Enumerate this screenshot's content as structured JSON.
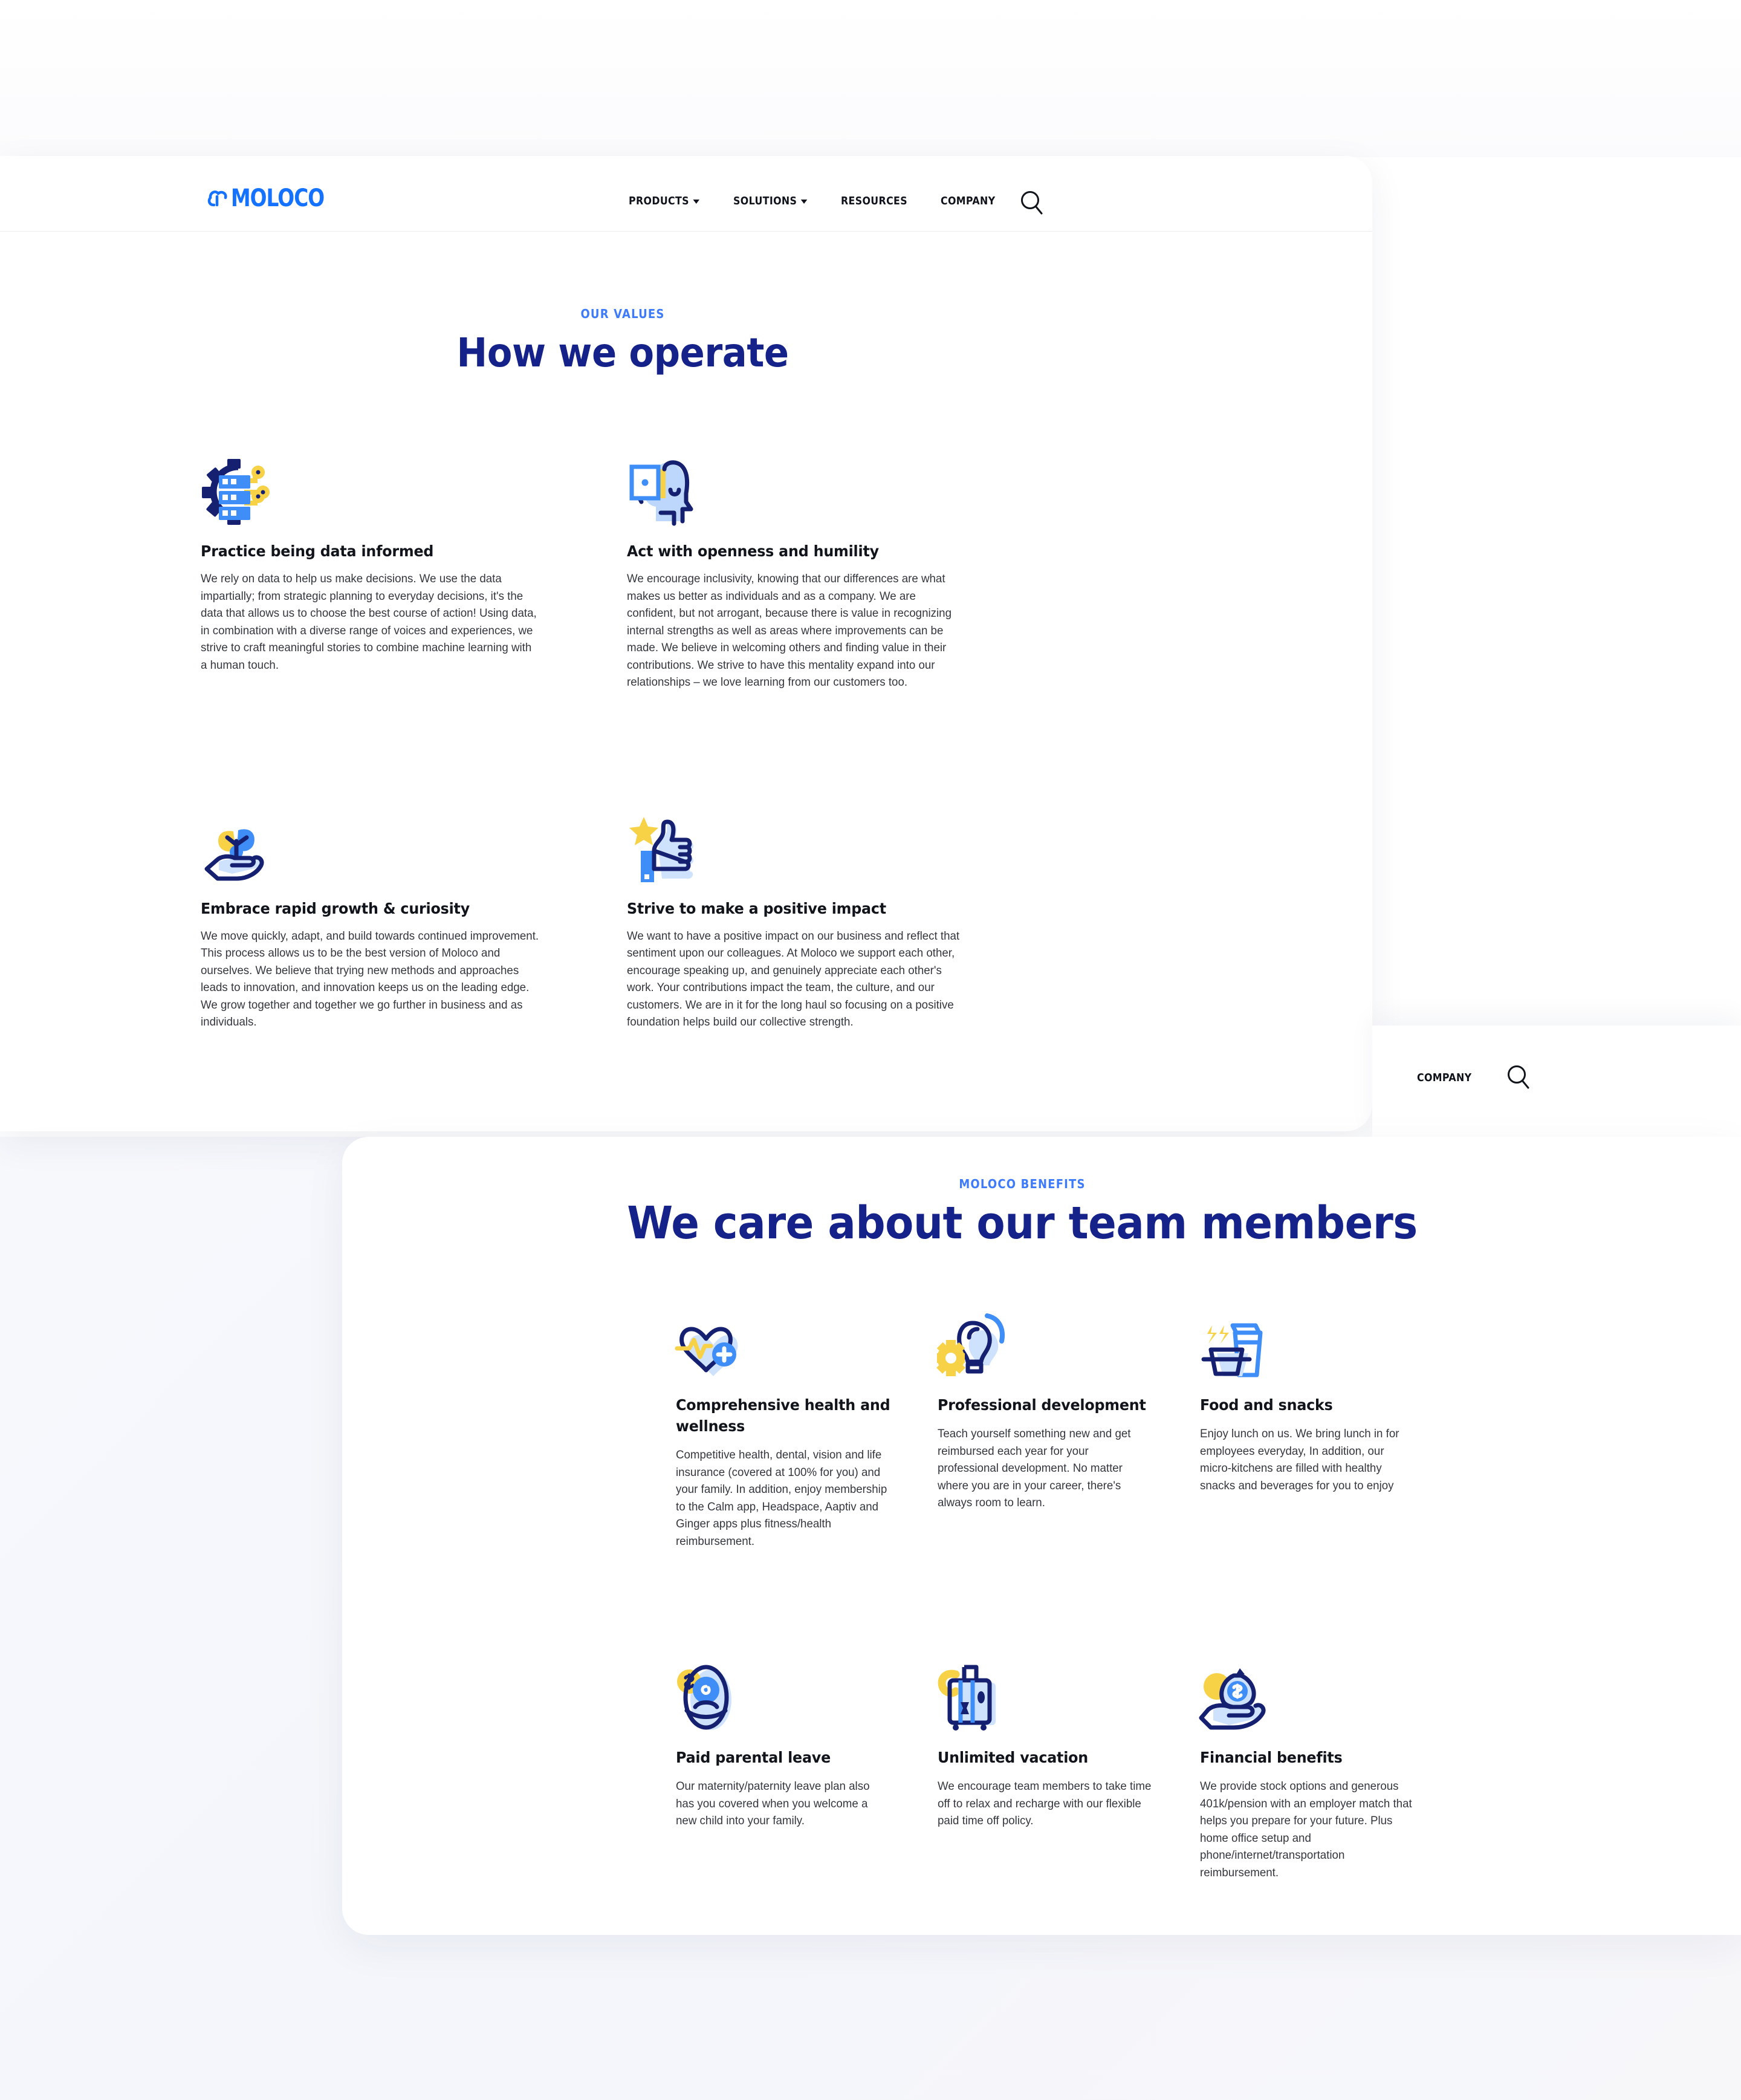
{
  "brand": {
    "name": "MOLOCO",
    "logo_icon": "moloco-cloud-logo",
    "primary_blue": "#1472ff",
    "navy": "#142289",
    "accent_yellow": "#f7d146"
  },
  "nav": {
    "items": [
      {
        "label": "PRODUCTS",
        "has_dropdown": true,
        "icon": "chevron-down-icon"
      },
      {
        "label": "SOLUTIONS",
        "has_dropdown": true,
        "icon": "chevron-down-icon"
      },
      {
        "label": "RESOURCES",
        "has_dropdown": false
      },
      {
        "label": "COMPANY",
        "has_dropdown": false
      }
    ],
    "search_icon": "search-icon"
  },
  "nav_fragment": {
    "label": "COMPANY",
    "search_icon": "search-icon"
  },
  "values_section": {
    "eyebrow": "OUR VALUES",
    "title": "How we operate",
    "items": [
      {
        "icon": "data-server-gear-icon",
        "title": "Practice being data informed",
        "body": "We rely on data to help us make decisions. We use the data impartially; from strategic planning to everyday decisions, it's the data that allows us to choose the best course of action! Using data, in combination with a diverse range of voices and experiences, we strive to craft meaningful stories to combine machine learning with a human touch."
      },
      {
        "icon": "open-mind-door-icon",
        "title": "Act with openness and humility",
        "body": "We encourage inclusivity, knowing that our differences are what makes us better as individuals and as a company. We are confident, but not arrogant, because there is value in recognizing internal strengths as well as areas where improvements can be made. We believe in welcoming others and finding value in their contributions. We strive to have this mentality expand into our relationships – we love learning from our customers too."
      },
      {
        "icon": "hand-plant-growth-icon",
        "title": "Embrace rapid growth & curiosity",
        "body": "We move quickly, adapt, and build towards continued improvement. This process allows us to be the best version of Moloco and ourselves. We believe that trying new methods and approaches leads to innovation, and innovation keeps us on the leading edge. We grow together and together we go further in business and as individuals."
      },
      {
        "icon": "thumbs-up-star-icon",
        "title": "Strive to make a positive impact",
        "body": "We want to have a positive impact on our business and reflect that sentiment upon our colleagues. At Moloco we support each other, encourage speaking up, and genuinely appreciate each other's work. Your contributions impact the team, the culture, and our customers. We are in it for the long haul so focusing on a positive foundation helps build our collective strength."
      }
    ]
  },
  "benefits_section": {
    "eyebrow": "MOLOCO BENEFITS",
    "title": "We care about our team members",
    "items": [
      {
        "icon": "heart-pulse-plus-icon",
        "title": "Comprehensive health and wellness",
        "body": "Competitive health, dental, vision and life insurance (covered at 100% for you) and your family. In addition, enjoy membership to the Calm app, Headspace, Aaptiv and Ginger apps plus fitness/health reimbursement."
      },
      {
        "icon": "lightbulb-gear-icon",
        "title": "Professional development",
        "body": "Teach yourself something new and get reimbursed each year for your professional development. No matter where you are in your career, there's always room to learn."
      },
      {
        "icon": "takeout-box-drink-icon",
        "title": "Food and snacks",
        "body": "Enjoy lunch on us. We bring lunch in for employees everyday, In addition, our micro-kitchens are filled with healthy snacks and beverages for you to enjoy"
      },
      {
        "icon": "baby-swaddle-coin-icon",
        "title": "Paid parental leave",
        "body": "Our maternity/paternity leave plan also has you covered when you welcome a new child into your family."
      },
      {
        "icon": "suitcase-luggage-icon",
        "title": "Unlimited vacation",
        "body": "We encourage team members to take time off to relax and recharge with our flexible paid time off policy."
      },
      {
        "icon": "hand-money-bag-icon",
        "title": "Financial benefits",
        "body": "We provide stock options and generous 401k/pension with an employer match that helps you prepare for your future. Plus home office setup and phone/internet/transportation reimbursement."
      }
    ]
  }
}
